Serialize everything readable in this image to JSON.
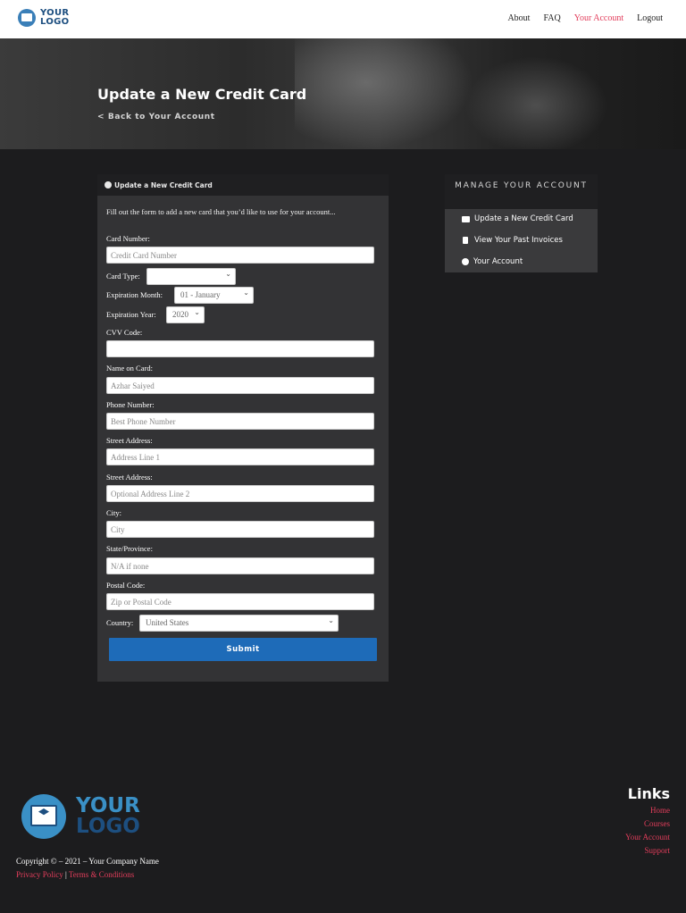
{
  "header": {
    "logo_text_line1": "YOUR",
    "logo_text_line2": "LOGO",
    "nav": [
      "About",
      "FAQ",
      "Your Account",
      "Logout"
    ],
    "active_nav": "Your Account"
  },
  "hero": {
    "title": "Update a New Credit Card",
    "back_link": "< Back to Your Account"
  },
  "form": {
    "panel_title": "Update a New Credit Card",
    "intro": "Fill out the form to add a new card that you’d like to use for your account...",
    "card_number_label": "Card Number:",
    "card_number_placeholder": "Credit Card Number",
    "card_type_label": "Card Type:",
    "card_type_value": "",
    "exp_month_label": "Expiration Month:",
    "exp_month_value": "01 - January",
    "exp_year_label": "Expiration Year:",
    "exp_year_value": "2020",
    "cvv_label": "CVV Code:",
    "cvv_value": "",
    "name_label": "Name on Card:",
    "name_value": "Azhar Saiyed",
    "phone_label": "Phone Number:",
    "phone_placeholder": "Best Phone Number",
    "street1_label": "Street Address:",
    "street1_placeholder": "Address Line 1",
    "street2_label": "Street Address:",
    "street2_placeholder": "Optional Address Line 2",
    "city_label": "City:",
    "city_placeholder": "City",
    "state_label": "State/Province:",
    "state_placeholder": "N/A if none",
    "postal_label": "Postal Code:",
    "postal_placeholder": "Zip or Postal Code",
    "country_label": "Country:",
    "country_value": "United States",
    "submit_label": "Submit"
  },
  "manage": {
    "title": "MANAGE YOUR ACCOUNT",
    "items": [
      "Update a New Credit Card",
      "View Your Past Invoices",
      "Your Account"
    ]
  },
  "footer": {
    "logo_line1": "YOUR",
    "logo_line2": "LOGO",
    "copyright": "Copyright © – 2021 – Your Company Name",
    "privacy": "Privacy Policy",
    "separator": "|",
    "terms": "Terms & Conditions",
    "links_title": "Links",
    "links": [
      "Home",
      "Courses",
      "Your Account",
      "Support"
    ]
  },
  "colors": {
    "accent": "#e23d5b",
    "button": "#1e6bb8",
    "background": "#1c1c1e",
    "panel": "#333335"
  }
}
